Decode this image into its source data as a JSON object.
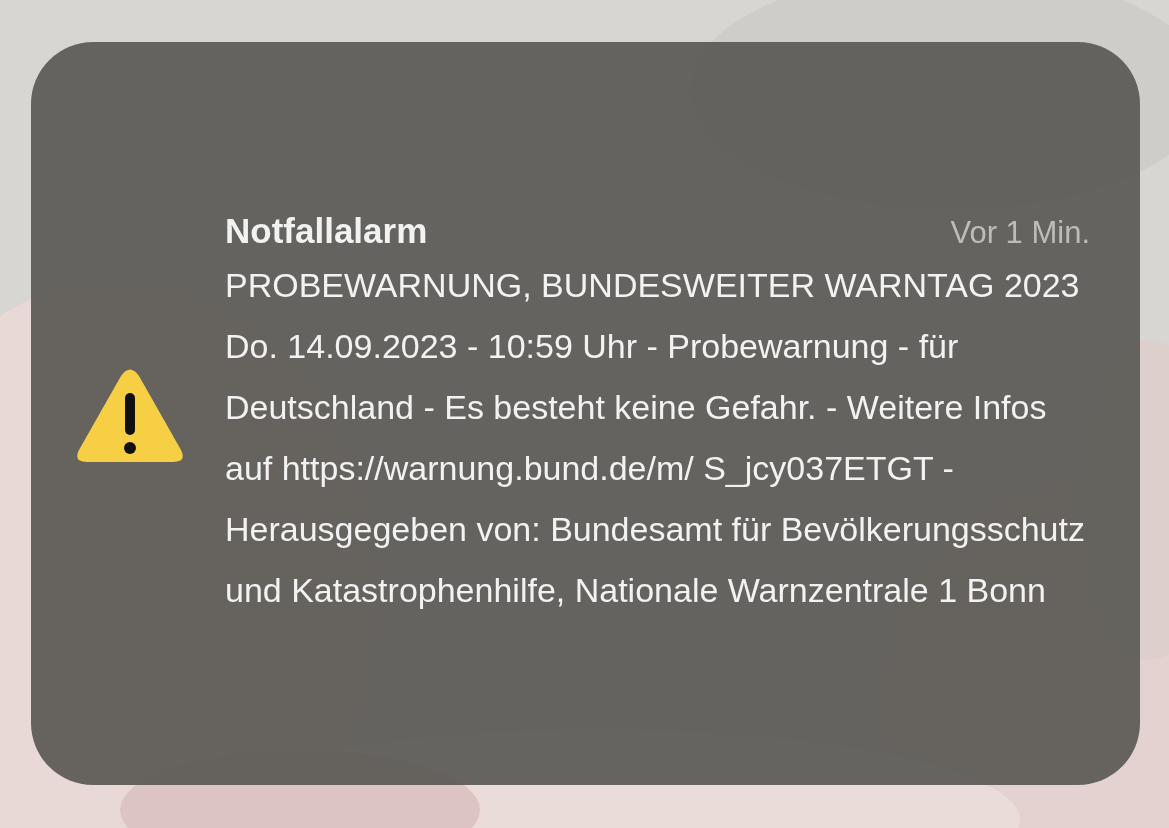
{
  "notification": {
    "kind": "warning",
    "app": "Notfallalarm",
    "time": "Vor 1 Min.",
    "message": "PROBEWARNUNG, BUNDESWEITER WARNTAG 2023 Do. 14.09.2023 - 10:59 Uhr - Probewarnung - für Deutschland - Es besteht keine Gefahr. - Weitere Infos auf https://warnung.bund.de/m/ S_jcy037ETGT - Herausgegeben von: Bundesamt für Bevölkerungsschutz und Katastrophenhilfe, Nationale Warnzentrale 1 Bonn"
  }
}
